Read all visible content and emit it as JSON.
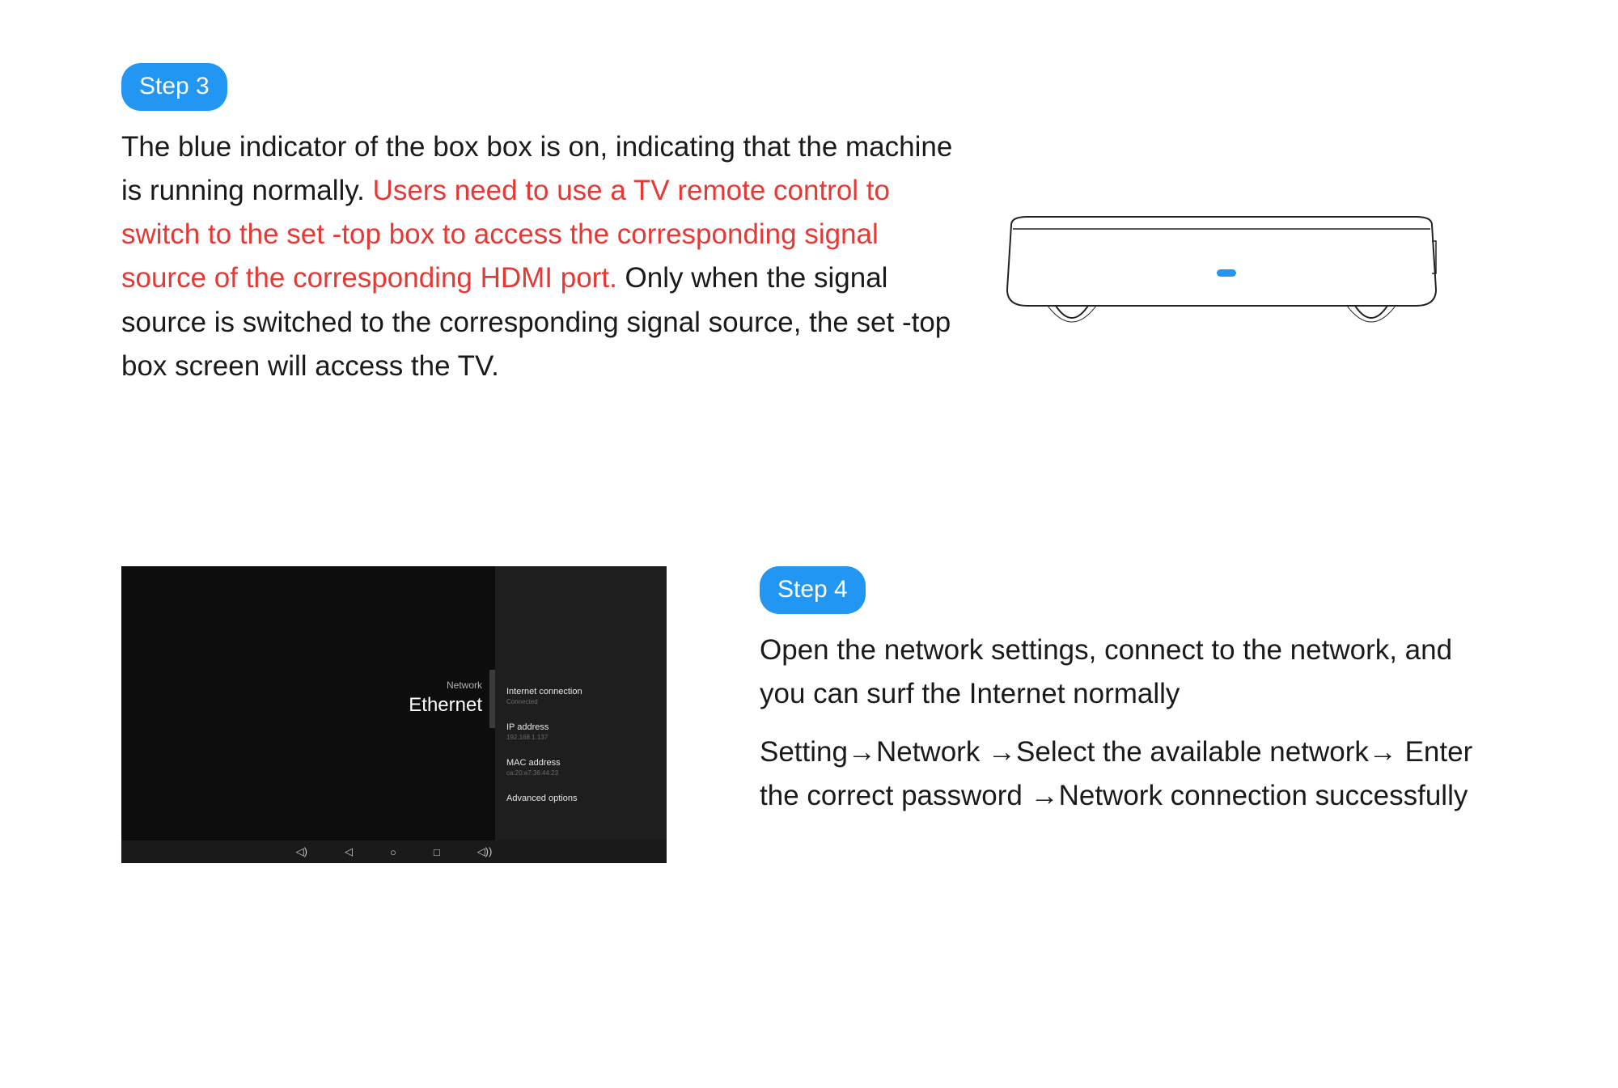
{
  "step3": {
    "badge": "Step 3",
    "text_before": "The blue indicator of the box box is on, indicating that the machine is running normally. ",
    "text_highlight": "Users need to use a TV remote control to switch to the set -top box to access the corresponding signal source of the corresponding HDMI port.",
    "text_after": " Only when the signal source is switched to the corresponding signal source, the set -top box screen will access the TV."
  },
  "step4": {
    "badge": "Step 4",
    "para1": "Open the network settings, connect to the network, and you can surf the Internet normally",
    "para2": "Setting→Network →Select the available network→ Enter the correct password →Network connection successfully"
  },
  "network_screenshot": {
    "label_network": "Network",
    "label_ethernet": "Ethernet",
    "items": {
      "internet_connection": "Internet connection",
      "internet_connection_sub": "Connected",
      "ip_address": "IP address",
      "ip_address_sub": "192.168.1.137",
      "mac_address": "MAC address",
      "mac_address_sub": "ca:20:a7:36:44:23",
      "advanced_options": "Advanced options"
    }
  }
}
